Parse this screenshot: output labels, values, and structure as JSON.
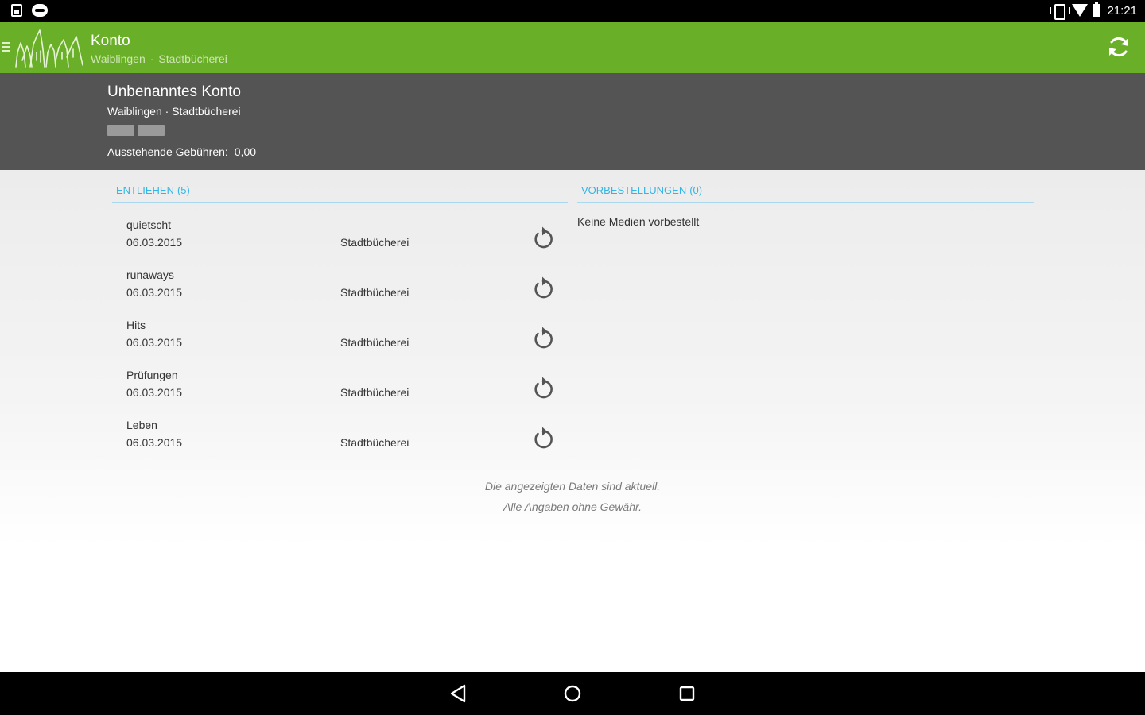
{
  "status_bar": {
    "time": "21:21",
    "left_icons": [
      "sim-card-icon",
      "message-icon"
    ],
    "right_icons": [
      "vibrate-icon",
      "wifi-icon",
      "battery-icon"
    ]
  },
  "action_bar": {
    "title": "Konto",
    "subtitle_city": "Waiblingen",
    "subtitle_separator": "·",
    "subtitle_library": "Stadtbücherei",
    "accent_color": "#6aaf28"
  },
  "account": {
    "name": "Unbenanntes Konto",
    "library": "Waiblingen · Stadtbücherei",
    "fees_label": "Ausstehende Gebühren:",
    "fees_value": "0,00"
  },
  "lent": {
    "label": "ENTLIEHEN",
    "count": "(5)",
    "items": [
      {
        "title": "quietscht",
        "date": "06.03.2015",
        "branch": "Stadtbücherei"
      },
      {
        "title": "runaways",
        "date": "06.03.2015",
        "branch": "Stadtbücherei"
      },
      {
        "title": "Hits",
        "date": "06.03.2015",
        "branch": "Stadtbücherei"
      },
      {
        "title": "Prüfungen",
        "date": "06.03.2015",
        "branch": "Stadtbücherei"
      },
      {
        "title": "Leben",
        "date": "06.03.2015",
        "branch": "Stadtbücherei"
      }
    ]
  },
  "reservations": {
    "label": "VORBESTELLUNGEN",
    "count": "(0)",
    "empty_text": "Keine Medien vorbestellt"
  },
  "footer": {
    "line1": "Die angezeigten Daten sind aktuell.",
    "line2": "Alle Angaben ohne Gewähr."
  },
  "navigation": {
    "icons": [
      "back-icon",
      "home-icon",
      "recent-apps-icon"
    ]
  }
}
